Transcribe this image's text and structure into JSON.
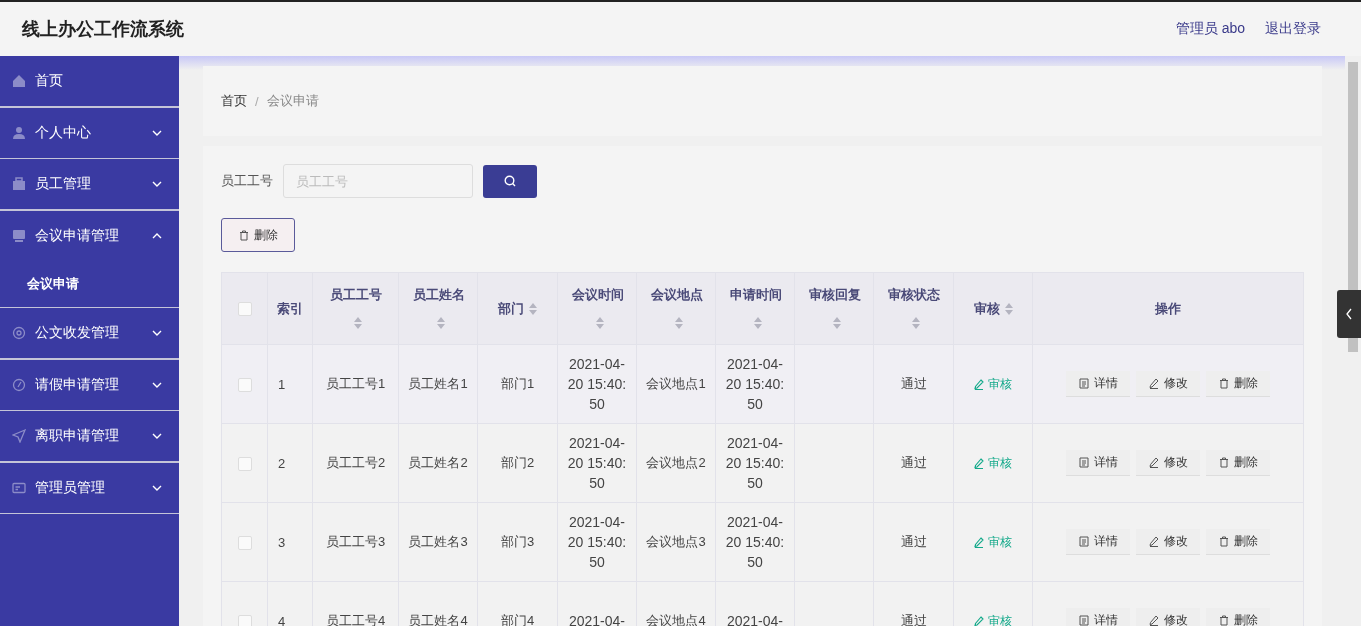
{
  "header": {
    "title": "线上办公工作流系统",
    "user": "管理员 abo",
    "logout": "退出登录"
  },
  "sidebar": {
    "items": [
      {
        "label": "首页",
        "kind": "link"
      },
      {
        "label": "个人中心",
        "kind": "submenu",
        "expanded": false
      },
      {
        "label": "员工管理",
        "kind": "submenu",
        "expanded": false
      },
      {
        "label": "会议申请管理",
        "kind": "submenu",
        "expanded": true,
        "children": [
          {
            "label": "会议申请",
            "selected": true
          }
        ]
      },
      {
        "label": "公文收发管理",
        "kind": "submenu",
        "expanded": false
      },
      {
        "label": "请假申请管理",
        "kind": "submenu",
        "expanded": false
      },
      {
        "label": "离职申请管理",
        "kind": "submenu",
        "expanded": false
      },
      {
        "label": "管理员管理",
        "kind": "submenu",
        "expanded": false
      }
    ]
  },
  "breadcrumb": {
    "items": [
      "首页",
      "会议申请"
    ],
    "separator": "/"
  },
  "search": {
    "label": "员工工号",
    "placeholder": "员工工号"
  },
  "delete_button": "删除",
  "table": {
    "select_all_checked": false,
    "columns": [
      {
        "label": "索引",
        "sortable": false
      },
      {
        "label": "员工工号",
        "sortable": true
      },
      {
        "label": "员工姓名",
        "sortable": true
      },
      {
        "label": "部门",
        "sortable": true
      },
      {
        "label": "会议时间",
        "sortable": true
      },
      {
        "label": "会议地点",
        "sortable": true
      },
      {
        "label": "申请时间",
        "sortable": true
      },
      {
        "label": "审核回复",
        "sortable": true
      },
      {
        "label": "审核状态",
        "sortable": true
      },
      {
        "label": "审核",
        "sortable": true
      },
      {
        "label": "操作",
        "sortable": false
      }
    ],
    "rows": [
      {
        "checked": false,
        "index": "1",
        "emp_no": "员工工号1",
        "name": "员工姓名1",
        "dept": "部门1",
        "meeting_time": "2021-04-20 15:40:50",
        "place": "会议地点1",
        "apply_time": "2021-04-20 15:40:50",
        "status": "通过",
        "review": "审核",
        "actions": [
          "详情",
          "修改",
          "删除"
        ]
      },
      {
        "checked": false,
        "index": "2",
        "emp_no": "员工工号2",
        "name": "员工姓名2",
        "dept": "部门2",
        "meeting_time": "2021-04-20 15:40:50",
        "place": "会议地点2",
        "apply_time": "2021-04-20 15:40:50",
        "status": "通过",
        "review": "审核",
        "actions": [
          "详情",
          "修改",
          "删除"
        ]
      },
      {
        "checked": false,
        "index": "3",
        "emp_no": "员工工号3",
        "name": "员工姓名3",
        "dept": "部门3",
        "meeting_time": "2021-04-20 15:40:50",
        "place": "会议地点3",
        "apply_time": "2021-04-20 15:40:50",
        "status": "通过",
        "review": "审核",
        "actions": [
          "详情",
          "修改",
          "删除"
        ]
      },
      {
        "checked": false,
        "index": "4",
        "emp_no": "员工工号4",
        "name": "员工姓名4",
        "dept": "部门4",
        "meeting_time": "2021-04-",
        "place": "会议地点4",
        "apply_time": "2021-04-",
        "status": "通过",
        "review": "审核",
        "actions": [
          "详情",
          "修改",
          "删除"
        ]
      }
    ]
  }
}
